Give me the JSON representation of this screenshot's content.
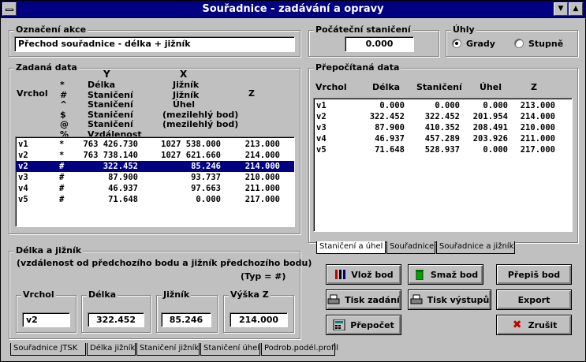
{
  "window": {
    "title": "Souřadnice - zadávání a opravy",
    "minimize_icon": "triangle-down-icon",
    "maximize_icon": "triangle-up-icon"
  },
  "akce": {
    "label": "Označení akce",
    "value": "Přechod souřadnice - délka + jižník"
  },
  "pocatecni": {
    "label": "Počáteční staničení",
    "value": "0.000"
  },
  "uhly": {
    "label": "Úhly",
    "options": [
      {
        "label": "Grady",
        "selected": true
      },
      {
        "label": "Stupně",
        "selected": false
      }
    ]
  },
  "zadana": {
    "label": "Zadaná data",
    "head_y": "Y",
    "head_x": "X",
    "head_vrchol": "Vrchol",
    "head_z": "Z",
    "legend": [
      {
        "sym": "*",
        "y": "Délka",
        "x": "Jižník"
      },
      {
        "sym": "#",
        "y": "Staničení",
        "x": "Jižník"
      },
      {
        "sym": "^",
        "y": "Staničení",
        "x": "Úhel"
      },
      {
        "sym": "$",
        "y": "Staničení",
        "x": "(mezilehlý bod)"
      },
      {
        "sym": "@",
        "y": "Staničení",
        "x": "(mezilehlý bod)"
      },
      {
        "sym": "%",
        "y": "Vzdálenost",
        "x": ""
      }
    ],
    "rows": [
      {
        "v": "v1",
        "t": "*",
        "y": "763 426.730",
        "x": "1027 538.000",
        "z": "213.000",
        "sel": false
      },
      {
        "v": "v2",
        "t": "*",
        "y": "763 738.140",
        "x": "1027 621.660",
        "z": "214.000",
        "sel": false
      },
      {
        "v": "v2",
        "t": "#",
        "y": "322.452",
        "x": "85.246",
        "z": "214.000",
        "sel": true
      },
      {
        "v": "v3",
        "t": "#",
        "y": "87.900",
        "x": "93.737",
        "z": "210.000",
        "sel": false
      },
      {
        "v": "v4",
        "t": "#",
        "y": "46.937",
        "x": "97.663",
        "z": "211.000",
        "sel": false
      },
      {
        "v": "v5",
        "t": "#",
        "y": "71.648",
        "x": "0.000",
        "z": "217.000",
        "sel": false
      }
    ]
  },
  "prepoc": {
    "label": "Přepočítaná data",
    "headers": [
      "Vrchol",
      "Délka",
      "Staničení",
      "Úhel",
      "Z"
    ],
    "rows": [
      {
        "v": "v1",
        "d": "0.000",
        "s": "0.000",
        "u": "0.000",
        "z": "213.000"
      },
      {
        "v": "v2",
        "d": "322.452",
        "s": "322.452",
        "u": "201.954",
        "z": "214.000"
      },
      {
        "v": "v3",
        "d": "87.900",
        "s": "410.352",
        "u": "208.491",
        "z": "210.000"
      },
      {
        "v": "v4",
        "d": "46.937",
        "s": "457.289",
        "u": "203.926",
        "z": "211.000"
      },
      {
        "v": "v5",
        "d": "71.648",
        "s": "528.937",
        "u": "0.000",
        "z": "217.000"
      }
    ],
    "tabs": [
      "Staničení a úhel",
      "Souřadnice",
      "Souřadnice a jižník"
    ]
  },
  "delka": {
    "label": "Délka a jižník",
    "desc": "(vzdálenost od předchozího bodu a jižník předchozího bodu)",
    "typ": "(Typ = #)",
    "vrchol_label": "Vrchol",
    "vrchol": "v2",
    "delka_label": "Délka",
    "delka": "322.452",
    "jiznik_label": "Jižník",
    "jiznik": "85.246",
    "vyska_label": "Výška Z",
    "vyska": "214.000"
  },
  "buttons": {
    "vloz": "Vlož bod",
    "smaz": "Smaž bod",
    "prepis": "Přepiš bod",
    "tisk_zadani": "Tisk zadání",
    "tisk_vystupu": "Tisk výstupů",
    "export": "Export",
    "prepocet": "Přepočet",
    "zrusit": "Zrušit"
  },
  "bottom_tabs": [
    "Souřadnice JTSK",
    "Délka jižník",
    "Staničení jižník",
    "Staničení úhel",
    "Podrob.podél.profil"
  ],
  "colors": {
    "title_bg": "#000080",
    "face": "#c0c0c0",
    "select": "#000080"
  }
}
